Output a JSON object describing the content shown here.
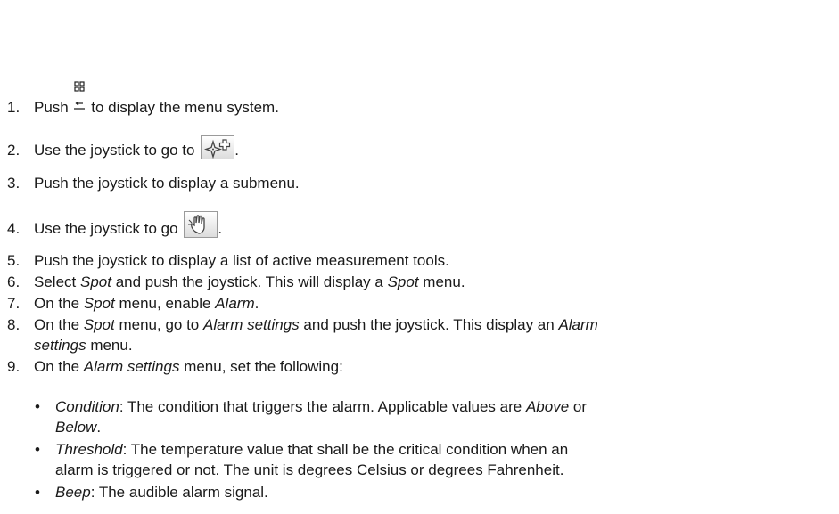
{
  "steps": [
    {
      "num": "1.",
      "before": "Push",
      "after": "to display the menu system.",
      "icon": "menu-back-button-icon"
    },
    {
      "num": "2.",
      "before": "Use the joystick to go to",
      "after": ".",
      "icon": "measurement-add-icon"
    },
    {
      "num": "3.",
      "text": "Push the joystick to display a submenu."
    },
    {
      "num": "4.",
      "before": "Use the joystick to go",
      "after": ".",
      "icon": "hand-tool-icon"
    },
    {
      "num": "5.",
      "text": "Push the joystick to display a list of active measurement tools."
    },
    {
      "num": "6.",
      "p1": "Select ",
      "i1": "Spot",
      "p2": " and push the joystick. This will display a ",
      "i2": "Spot",
      "p3": " menu."
    },
    {
      "num": "7.",
      "p1": "On the ",
      "i1": "Spot",
      "p2": " menu, enable ",
      "i2": "Alarm",
      "p3": "."
    },
    {
      "num": "8.",
      "p1": "On the ",
      "i1": "Spot",
      "p2": " menu, go to ",
      "i2": "Alarm settings",
      "p3": " and push the joystick. This display an ",
      "i3": "Alarm",
      "i4": "settings",
      "p4": " menu."
    },
    {
      "num": "9.",
      "p1": "On the ",
      "i1": "Alarm settings",
      "p2": " menu, set the following:"
    }
  ],
  "bullets": [
    {
      "term": "Condition",
      "t1": ": The condition that triggers the alarm. Applicable values are ",
      "v1": "Above",
      "t2": " or",
      "v2": "Below",
      "t3": "."
    },
    {
      "term": "Threshold",
      "t1": ": The temperature value that shall be the critical condition when an",
      "line2": "alarm is triggered or not. The unit is degrees Celsius or degrees Fahrenheit."
    },
    {
      "term": "Beep",
      "t1": ": The audible alarm signal."
    }
  ],
  "bullet_char": "•"
}
